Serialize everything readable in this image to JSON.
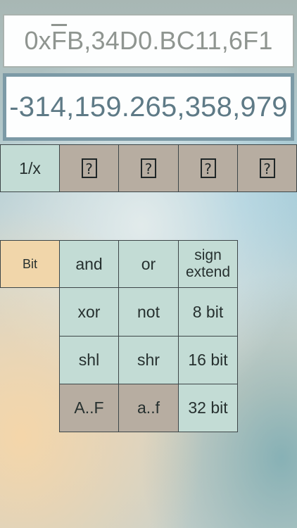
{
  "display": {
    "hex_prefix": "0x",
    "hex_overlined": "F",
    "hex_rest": "B,34D0.BC11,6F1",
    "decimal": "-314,159.265,358,979"
  },
  "top_row": [
    {
      "label": "1/x"
    },
    {
      "icon": "missing-glyph-icon"
    },
    {
      "icon": "missing-glyph-icon"
    },
    {
      "icon": "missing-glyph-icon"
    },
    {
      "icon": "missing-glyph-icon"
    }
  ],
  "bit_panel": {
    "mode_label": "Bit",
    "keys": {
      "and": "and",
      "or": "or",
      "sign_extend": "sign\nextend",
      "xor": "xor",
      "not": "not",
      "bit8": "8 bit",
      "shl": "shl",
      "shr": "shr",
      "bit16": "16 bit",
      "hex_upper": "A..F",
      "hex_lower": "a..f",
      "bit32": "32 bit"
    }
  },
  "colors": {
    "key_mint": "#c3dcd5",
    "key_stone": "#b7ada1",
    "key_peach": "#f1d6aa",
    "display_text": "#687d85"
  }
}
